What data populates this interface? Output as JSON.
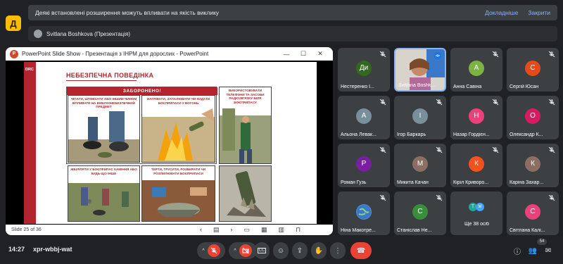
{
  "banner": {
    "text": "Деякі встановлені розширення можуть впливати на якість виклику",
    "details_label": "Докладніше",
    "close_label": "Закрити"
  },
  "presenting": {
    "text": "Svitlana Boshkova (Презентація)"
  },
  "window": {
    "title": "PowerPoint Slide Show  -  Презентація з ІНРМ для дорослих - PowerPoint",
    "app_letter": "P"
  },
  "slide": {
    "brand": "DRC",
    "heading": "НЕБЕЗПЕЧНА ПОВЕДІНКА",
    "forbidden": "ЗАБОРОНЕНО!",
    "panels": [
      "Чіпати, штовхати або іншим чином впливати на вибухонебезпечний предмет",
      "Нагрівати, запалювати чи кидати боєприпаси у вогонь",
      "Використовувати телефони та засоби радіозв'язку біля боєприпасу",
      "Жбурляти у боєприпас каміння або будь-що інше",
      "Терти, трусити, розбирати чи розпилювати боєприпаси",
      ""
    ],
    "counter": "Slide 25 of 36"
  },
  "participants": [
    {
      "name": "Нестеренко І...",
      "initials": "Ди",
      "color": "#33691e"
    },
    {
      "name": "Svitlana Boshk...",
      "initials": "",
      "color": "#5f6368",
      "active": true
    },
    {
      "name": "Анна Савіна",
      "initials": "А",
      "color": "#7cb342"
    },
    {
      "name": "Сергій Юсан",
      "initials": "С",
      "color": "#e64a19"
    },
    {
      "name": "Альона Левак...",
      "initials": "А",
      "color": "#78909c"
    },
    {
      "name": "Ігор Баркарь",
      "initials": "І",
      "color": "#78909c"
    },
    {
      "name": "Назар Гордієн...",
      "initials": "Н",
      "color": "#ec407a"
    },
    {
      "name": "Олександр К...",
      "initials": "О",
      "color": "#d81b60"
    },
    {
      "name": "Роман Гузь",
      "initials": "Р",
      "color": "#7b1fa2"
    },
    {
      "name": "Микита Качан",
      "initials": "М",
      "color": "#8d6e63"
    },
    {
      "name": "Кіріл Криворо...",
      "initials": "К",
      "color": "#f4511e"
    },
    {
      "name": "Каріна Захар...",
      "initials": "К",
      "color": "#8d6e63"
    },
    {
      "name": "Ніна Макотре...",
      "initials": "",
      "color": "#4a90d9"
    },
    {
      "name": "Станіслав Не...",
      "initials": "С",
      "color": "#388e3c"
    },
    {
      "name": "Ще 38 осіб",
      "initials": "Т М",
      "color": "#26a69a"
    },
    {
      "name": "Світлана Калі...",
      "initials": "С",
      "color": "#ec407a"
    }
  ],
  "bottom": {
    "time": "14:27",
    "meet_code": "xpr-wbbj-wat",
    "participant_count": "54",
    "cc_label": "CC"
  },
  "colors": {
    "background": "#202124",
    "tile": "#3c4043",
    "end_call": "#ea4335",
    "accent": "#8ab4f8"
  }
}
